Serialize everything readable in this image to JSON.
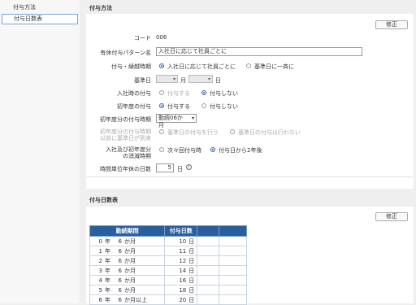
{
  "sidebar": {
    "items": [
      {
        "label": "付与方法"
      },
      {
        "label": "付与日数表"
      }
    ]
  },
  "section1": {
    "title": "付与方法",
    "edit_label": "修正",
    "code_label": "コード",
    "code_value": "006",
    "pattern_label": "有休付与パターン名",
    "pattern_value": "入社日に応じて社員ごとに",
    "timing_label": "付与・繰越時期",
    "timing_opt1": "入社日に応じて社員ごとに",
    "timing_opt2": "基準日に一斉に",
    "base_label": "基準日",
    "month_label": "月",
    "day_label": "日",
    "join_label": "入社時の付与",
    "join_opt1": "付与する",
    "join_opt2": "付与しない",
    "first_label": "初年度の付与",
    "first_opt1": "付与する",
    "first_opt2": "付与しない",
    "first_time_label": "初年度分の付与時期",
    "first_time_value": "勤続06か月",
    "pre_label1": "初年度分の付与時期",
    "pre_label2": "以前に基準日が到来",
    "pre_opt1": "基準日の付与を行う",
    "pre_opt2": "基準日の付与は行わない",
    "expire_label1": "入社及び初年度分",
    "expire_label2": "の消滅時期",
    "expire_opt1": "次々回付与時",
    "expire_opt2": "付与日から2年後",
    "hours_label": "時間単位年休の日数",
    "hours_value": "5",
    "hours_unit": "日"
  },
  "section2": {
    "title": "付与日数表",
    "edit_label": "修正",
    "col1": "勤続期間",
    "col2": "付与日数",
    "rows": [
      {
        "years": "0",
        "y": "年",
        "months": "6",
        "m": "か月",
        "days": "10",
        "d": "日"
      },
      {
        "years": "1",
        "y": "年",
        "months": "6",
        "m": "か月",
        "days": "11",
        "d": "日"
      },
      {
        "years": "2",
        "y": "年",
        "months": "6",
        "m": "か月",
        "days": "12",
        "d": "日"
      },
      {
        "years": "3",
        "y": "年",
        "months": "6",
        "m": "か月",
        "days": "14",
        "d": "日"
      },
      {
        "years": "4",
        "y": "年",
        "months": "6",
        "m": "か月",
        "days": "16",
        "d": "日"
      },
      {
        "years": "5",
        "y": "年",
        "months": "6",
        "m": "か月",
        "days": "18",
        "d": "日"
      },
      {
        "years": "6",
        "y": "年",
        "months": "6",
        "m": "か月以上",
        "days": "20",
        "d": "日"
      }
    ]
  }
}
